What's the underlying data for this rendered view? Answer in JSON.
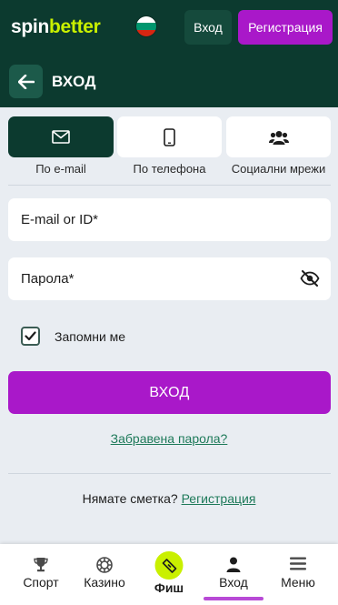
{
  "header": {
    "logo_spin": "spin",
    "logo_better": "better",
    "login_label": "Вход",
    "register_label": "Регистрация"
  },
  "subheader": {
    "title": "ВХОД"
  },
  "login_tabs": [
    {
      "label": "По e-mail",
      "icon": "envelope-icon",
      "active": true
    },
    {
      "label": "По телефона",
      "icon": "phone-icon",
      "active": false
    },
    {
      "label": "Социални мрежи",
      "icon": "users-icon",
      "active": false
    }
  ],
  "form": {
    "email_placeholder": "E-mail or ID*",
    "password_placeholder": "Парола*",
    "remember_label": "Запомни ме",
    "remember_checked": true,
    "submit_label": "ВХОД",
    "forgot_label": "Забравена парола?",
    "no_account_text": "Нямате сметка?",
    "register_link": "Регистрация"
  },
  "bottom_nav": [
    {
      "label": "Спорт",
      "icon": "trophy-icon"
    },
    {
      "label": "Казино",
      "icon": "chip-icon"
    },
    {
      "label": "Фиш",
      "icon": "ticket-icon"
    },
    {
      "label": "Вход",
      "icon": "user-icon",
      "active": true
    },
    {
      "label": "Меню",
      "icon": "menu-icon"
    }
  ],
  "colors": {
    "brand_dark": "#0c3a2f",
    "accent_purple": "#a918c9",
    "logo_lime": "#c9f000",
    "link_green": "#1e7a5a",
    "background": "#e9edf2"
  }
}
